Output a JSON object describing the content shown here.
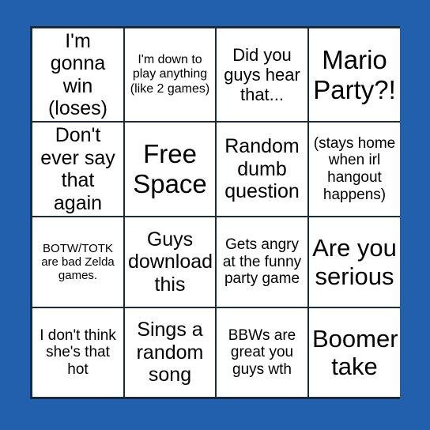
{
  "colors": {
    "background": "#2260ad",
    "grid_line": "#1c2b3a",
    "cell_background": "#ffffff",
    "text": "#000000"
  },
  "card": {
    "rows": 4,
    "columns": 4,
    "cells": [
      {
        "text": "I'm gonna win (loses)",
        "size": "fs-l"
      },
      {
        "text": "I'm down to play anything (like 2 games)",
        "size": "fs-xs"
      },
      {
        "text": "Did you guys hear that...",
        "size": "fs-m"
      },
      {
        "text": "Mario Party?!",
        "size": "fs-xxl"
      },
      {
        "text": "Don't ever say that again",
        "size": "fs-l"
      },
      {
        "text": "Free Space",
        "size": "fs-xxl"
      },
      {
        "text": "Random dumb question",
        "size": "fs-l"
      },
      {
        "text": "(stays home when irl hangout happens)",
        "size": "fs-s"
      },
      {
        "text": "BOTW/TOTK are bad Zelda games.",
        "size": "fs-xxs"
      },
      {
        "text": "Guys download this",
        "size": "fs-l"
      },
      {
        "text": "Gets angry at the funny party game",
        "size": "fs-s"
      },
      {
        "text": "Are you serious",
        "size": "fs-xl"
      },
      {
        "text": "I don't think she's that hot",
        "size": "fs-s"
      },
      {
        "text": "Sings a random song",
        "size": "fs-l"
      },
      {
        "text": "BBWs are great you guys wth",
        "size": "fs-s"
      },
      {
        "text": "Boomer take",
        "size": "fs-xl"
      }
    ]
  }
}
